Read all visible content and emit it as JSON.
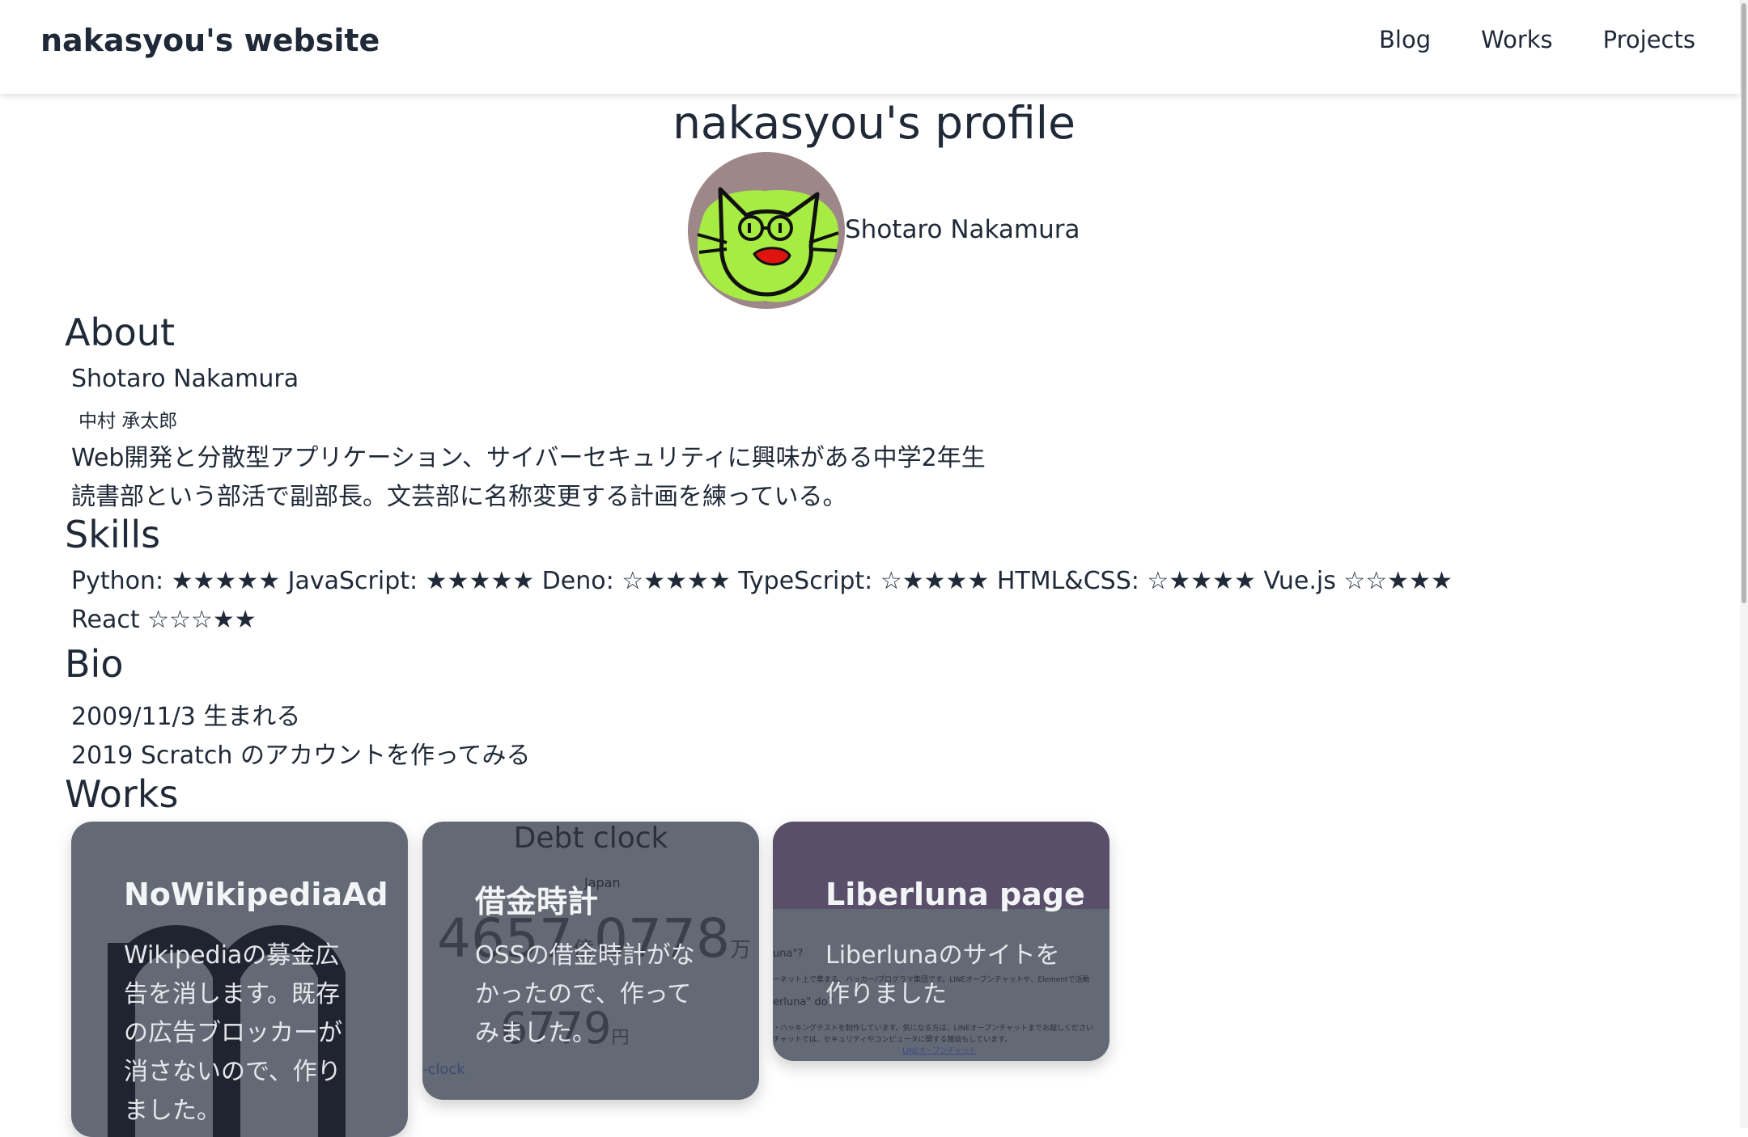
{
  "navbar": {
    "brand": "nakasyou's website",
    "links": [
      "Blog",
      "Works",
      "Projects"
    ]
  },
  "profile": {
    "title": "nakasyou's profile",
    "name": "Shotaro Nakamura"
  },
  "about": {
    "heading": "About",
    "name_en": "Shotaro Nakamura",
    "name_ja": "中村 承太郎",
    "lines": [
      "Web開発と分散型アプリケーション、サイバーセキュリティに興味がある中学2年生",
      "読書部という部活で副部長。文芸部に名称変更する計画を練っている。"
    ]
  },
  "skills": {
    "heading": "Skills",
    "line1": "Python: ★★★★★ JavaScript: ★★★★★ Deno: ☆★★★★ TypeScript: ☆★★★★ HTML&CSS: ☆★★★★ Vue.js ☆☆★★★",
    "line2": "React ☆☆☆★★"
  },
  "bio": {
    "heading": "Bio",
    "items": [
      "2009/11/3 生まれる",
      "2019 Scratch のアカウントを作ってみる"
    ]
  },
  "works": {
    "heading": "Works",
    "cards": [
      {
        "title": "NoWikipediaAd",
        "description": "Wikipediaの募金広告を消します。既存の広告ブロッカーが消さないので、作りました。"
      },
      {
        "title": "借金時計",
        "description": "OSSの借金時計がなかったので、作ってみました。",
        "bg_title": "Debt clock",
        "bg_sub": "Japan",
        "bg_number1": "4657",
        "bg_unit1": "億",
        "bg_number2": "0778",
        "bg_unit2": "万",
        "bg_number3": "6779",
        "bg_unit3": "円",
        "bg_link": "-clock"
      },
      {
        "title": "Liberluna page",
        "description": "Liberlunaのサイトを作りました",
        "bg_q1": "una\"?",
        "bg_text1": "ーネット上で集まる、ハッカー/プログラマ集団です。LINEオープンチャットや、Elementで活動",
        "bg_q2": "erluna\" do?",
        "bg_text2": "・ハッキングテストを制作しています。気になる方は、LINEオープンチャットまでお越しください",
        "bg_text3": "チャットでは、セキュリティやコンピュータに関する雑談もしています。",
        "bg_link": "LINEオープンチャット"
      }
    ]
  },
  "colors": {
    "text": "#1f2937",
    "card_bg": "#646a75",
    "avatar_bg": "#9e8788",
    "cat_green": "#a6ec43",
    "liberluna_header": "#5a4f6a"
  }
}
